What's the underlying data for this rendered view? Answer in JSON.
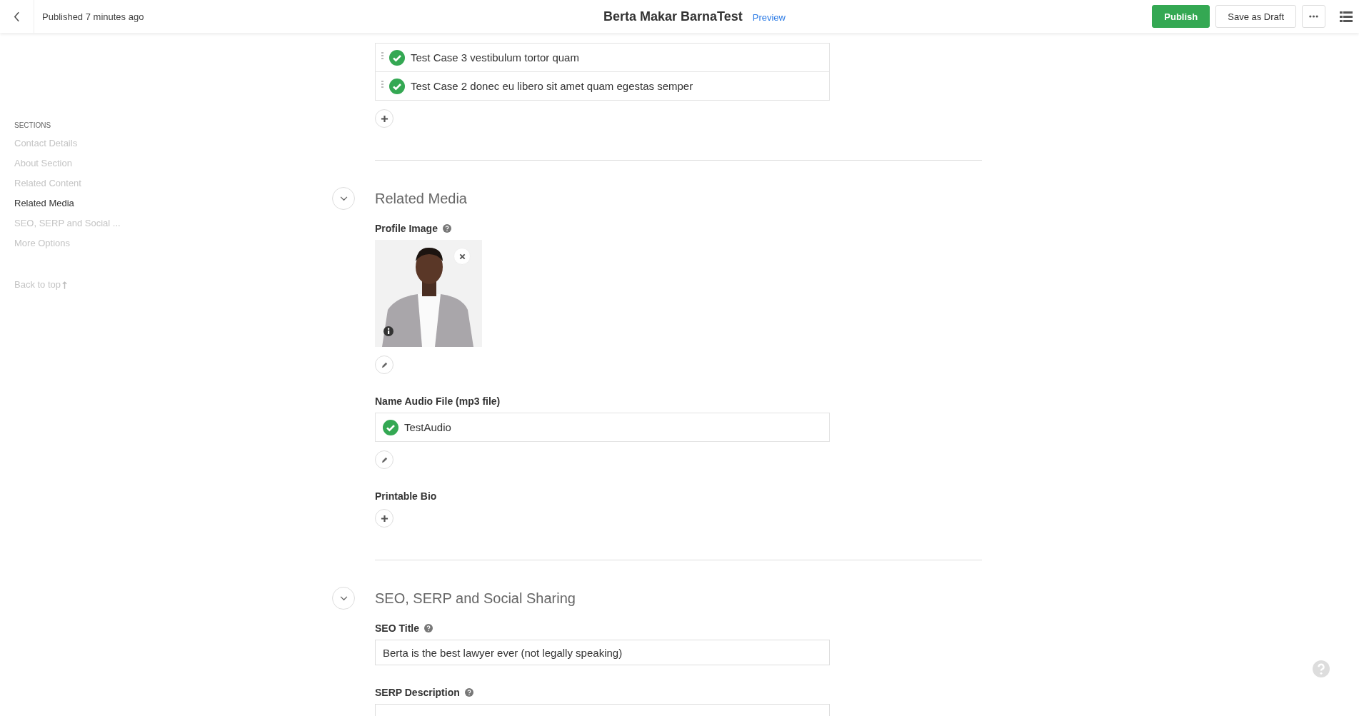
{
  "header": {
    "status": "Published 7 minutes ago",
    "title": "Berta Makar BarnaTest",
    "preview_link": "Preview",
    "buttons": [
      {
        "label": "Publish",
        "kind": "primary"
      },
      {
        "label": "Save as Draft",
        "kind": "secondary"
      }
    ]
  },
  "sidebar": {
    "heading": "SECTIONS",
    "items": [
      {
        "label": "Contact Details",
        "selected": false
      },
      {
        "label": "About Section",
        "selected": false
      },
      {
        "label": "Related Content",
        "selected": false
      },
      {
        "label": "Related Media",
        "selected": true
      },
      {
        "label": "SEO, SERP and Social ...",
        "selected": false
      },
      {
        "label": "More Options",
        "selected": false
      }
    ],
    "back_to_top": "Back to top"
  },
  "related_cases": {
    "items": [
      {
        "title": "Test Case 3 vestibulum tortor quam"
      },
      {
        "title": "Test Case 2 donec eu libero sit amet quam egestas semper"
      }
    ]
  },
  "sections": [
    {
      "title": "Related Media",
      "expanded": true,
      "fields": [
        {
          "label": "Profile Image",
          "help": true
        },
        {
          "kind": "files",
          "label": "Name Audio File (mp3 file)",
          "help": false,
          "items": [
            {
              "title": "TestAudio"
            }
          ]
        },
        {
          "kind": "empty",
          "label": "Printable Bio",
          "help": false
        }
      ]
    },
    {
      "title": "SEO, SERP and Social Sharing",
      "expanded": true,
      "fields": [
        {
          "kind": "text",
          "label": "SEO Title",
          "help": true,
          "value": "Berta is the best lawyer ever (not legally speaking)"
        },
        {
          "kind": "text",
          "label": "SERP Description",
          "help": true
        }
      ]
    }
  ]
}
